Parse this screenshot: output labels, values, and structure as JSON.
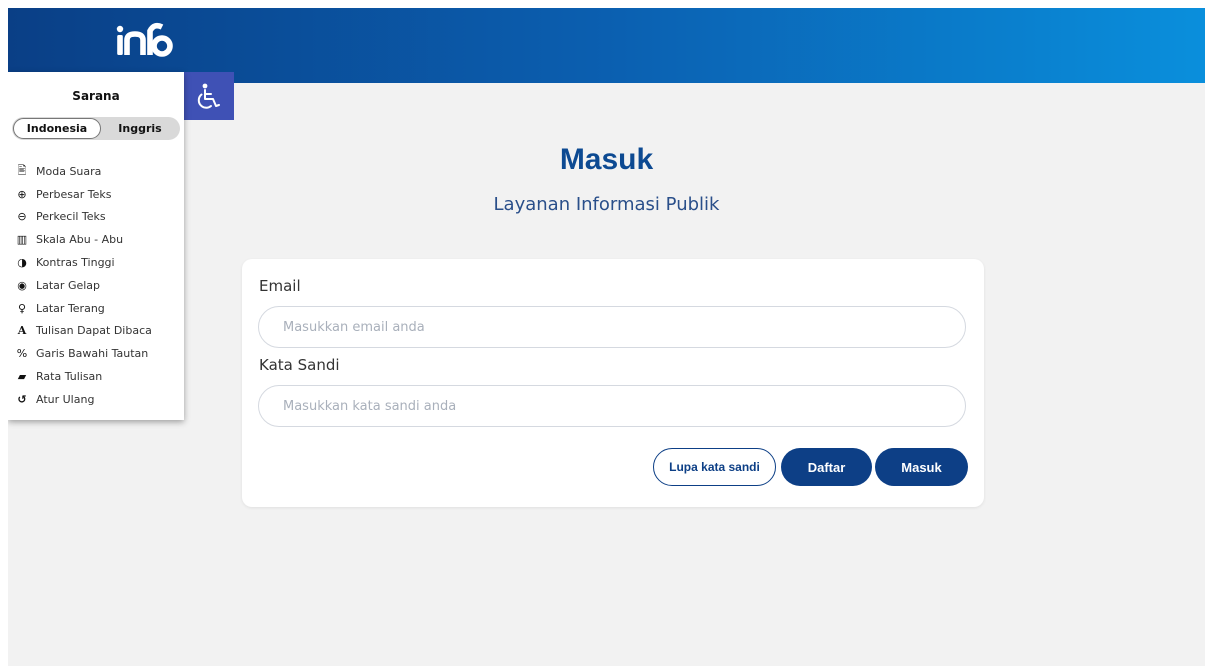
{
  "colors": {
    "header_start": "#0a3f86",
    "header_end": "#0a8fdc",
    "accent": "#0d3f86",
    "a11y_toggle": "#3f51b5"
  },
  "header": {
    "logo_text": "inف"
  },
  "accessibility": {
    "toggle_icon": "wheelchair-icon",
    "title": "Sarana",
    "languages": {
      "active": "Indonesia",
      "inactive": "Inggris"
    },
    "tools": [
      {
        "label": "Moda Suara",
        "icon": "audio-file-icon",
        "glyph": "🖹"
      },
      {
        "label": "Perbesar Teks",
        "icon": "zoom-in-icon",
        "glyph": "⊕"
      },
      {
        "label": "Perkecil Teks",
        "icon": "zoom-out-icon",
        "glyph": "⊖"
      },
      {
        "label": "Skala Abu - Abu",
        "icon": "barcode-icon",
        "glyph": "▥"
      },
      {
        "label": "Kontras Tinggi",
        "icon": "contrast-icon",
        "glyph": "◑"
      },
      {
        "label": "Latar Gelap",
        "icon": "eye-icon",
        "glyph": "◉"
      },
      {
        "label": "Latar Terang",
        "icon": "lightbulb-icon",
        "glyph": "♀"
      },
      {
        "label": "Tulisan Dapat Dibaca",
        "icon": "font-icon",
        "glyph": "A"
      },
      {
        "label": "Garis Bawahi Tautan",
        "icon": "link-icon",
        "glyph": "%"
      },
      {
        "label": "Rata Tulisan",
        "icon": "comment-icon",
        "glyph": "▰"
      },
      {
        "label": "Atur Ulang",
        "icon": "reset-icon",
        "glyph": "↺"
      }
    ]
  },
  "main": {
    "title": "Masuk",
    "subtitle": "Layanan Informasi Publik"
  },
  "form": {
    "email_label": "Email",
    "email_placeholder": "Masukkan email anda",
    "email_value": "",
    "password_label": "Kata Sandi",
    "password_placeholder": "Masukkan kata sandi anda",
    "password_value": "",
    "forgot_label": "Lupa kata sandi",
    "register_label": "Daftar",
    "submit_label": "Masuk"
  }
}
